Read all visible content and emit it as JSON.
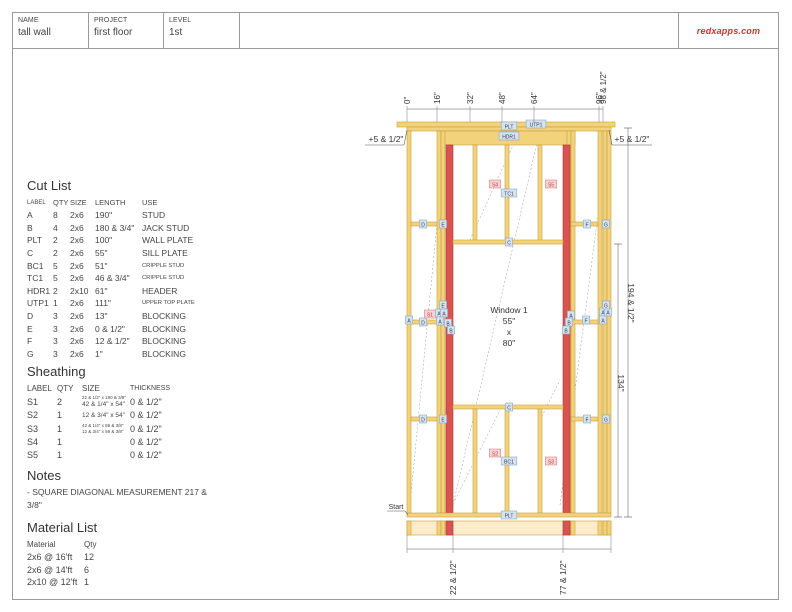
{
  "header": {
    "name_label": "NAME",
    "name_value": "tall wall",
    "project_label": "PROJECT",
    "project_value": "first floor",
    "level_label": "LEVEL",
    "level_value": "1st",
    "logo": "redxapps.com",
    "logo_color": "#d23030"
  },
  "cut_list": {
    "title": "Cut List",
    "headers": [
      "LABEL",
      "QTY",
      "SIZE",
      "LENGTH",
      "USE"
    ],
    "rows": [
      {
        "label": "A",
        "qty": "8",
        "size": "2x6",
        "length": "190\"",
        "use": "STUD",
        "small": false
      },
      {
        "label": "B",
        "qty": "4",
        "size": "2x6",
        "length": "180 & 3/4\"",
        "use": "JACK STUD",
        "small": false
      },
      {
        "label": "PLT",
        "qty": "2",
        "size": "2x6",
        "length": "100\"",
        "use": "WALL PLATE",
        "small": false
      },
      {
        "label": "C",
        "qty": "2",
        "size": "2x6",
        "length": "55\"",
        "use": "SILL PLATE",
        "small": false
      },
      {
        "label": "BC1",
        "qty": "5",
        "size": "2x6",
        "length": "51\"",
        "use": "CRIPPLE STUD",
        "small": true
      },
      {
        "label": "TC1",
        "qty": "5",
        "size": "2x6",
        "length": "46 & 3/4\"",
        "use": "CRIPPLE STUD",
        "small": true
      },
      {
        "label": "HDR1",
        "qty": "2",
        "size": "2x10",
        "length": "61\"",
        "use": "HEADER",
        "small": false
      },
      {
        "label": "UTP1",
        "qty": "1",
        "size": "2x6",
        "length": "111\"",
        "use": "UPPER TOP PLATE",
        "small": true
      },
      {
        "label": "D",
        "qty": "3",
        "size": "2x6",
        "length": "13\"",
        "use": "BLOCKING",
        "small": false
      },
      {
        "label": "E",
        "qty": "3",
        "size": "2x6",
        "length": "0 & 1/2\"",
        "use": "BLOCKING",
        "small": false
      },
      {
        "label": "F",
        "qty": "3",
        "size": "2x6",
        "length": "12 & 1/2\"",
        "use": "BLOCKING",
        "small": false
      },
      {
        "label": "G",
        "qty": "3",
        "size": "2x6",
        "length": "1\"",
        "use": "BLOCKING",
        "small": false
      }
    ]
  },
  "sheathing": {
    "title": "Sheathing",
    "headers": [
      "LABEL",
      "QTY",
      "SIZE",
      "THICKNESS"
    ],
    "rows": [
      {
        "label": "S1",
        "qty": "2",
        "size_lines": [
          "22 & 1/2\" x 190 & 3/8\"",
          "42 & 1/4\" x 54\""
        ],
        "thickness": "0 & 1/2\""
      },
      {
        "label": "S2",
        "qty": "1",
        "size_lines": [
          "12 & 3/4\" x 54\""
        ],
        "thickness": "0 & 1/2\""
      },
      {
        "label": "S3",
        "qty": "1",
        "size_lines": [
          "42 & 1/4\" x 59 & 3/8\"",
          "12 & 3/4\" x 59 & 3/8\""
        ],
        "thickness": "0 & 1/2\""
      },
      {
        "label": "S4",
        "qty": "1",
        "size_lines": [],
        "thickness": "0 & 1/2\""
      },
      {
        "label": "S5",
        "qty": "1",
        "size_lines": [],
        "thickness": "0 & 1/2\""
      }
    ]
  },
  "notes": {
    "title": "Notes",
    "text": "- SQUARE DIAGONAL MEASUREMENT 217 & 3/8\""
  },
  "material_list": {
    "title": "Material List",
    "headers": [
      "Material",
      "Qty"
    ],
    "rows": [
      {
        "material": "2x6 @ 16'ft",
        "qty": "12"
      },
      {
        "material": "2x6 @ 14'ft",
        "qty": "6"
      },
      {
        "material": "2x10 @ 12'ft",
        "qty": "1"
      }
    ]
  },
  "drawing": {
    "colors": {
      "wood": "#f2d27a",
      "wood_edge": "#c9a13c",
      "jack": "#d9534f",
      "tag_bg": "#d6e4f0",
      "tag_border": "#8aa6c1",
      "sheath_tag_bg": "#f6d2d2",
      "sheath_tag_border": "#d48a8a"
    },
    "top_ticks": [
      "0\"",
      "16\"",
      "32\"",
      "48\"",
      "64\"",
      "96\"",
      "98 & 1/2\""
    ],
    "overhang_left": "+5 & 1/2\"",
    "overhang_right": "+5 & 1/2\"",
    "height_total": "194 & 1/2\"",
    "height_window_bottom": "134\"",
    "bottom_dims": [
      "22 & 1/2\"",
      "77 & 1/2\""
    ],
    "start_label": "Start",
    "window": {
      "name": "Window 1",
      "width": "55\"",
      "x": "x",
      "height": "80\""
    },
    "tags": {
      "plt": "PLT",
      "hdr": "HDR1",
      "utp": "UTP1",
      "tc": "TC1",
      "bc": "BC1",
      "c": "C",
      "a": "A",
      "b": "B",
      "d": "D",
      "e": "E",
      "f": "F",
      "g": "G",
      "s1": "S1",
      "s2": "S2",
      "s3": "S3",
      "s4": "S4",
      "s5": "S5"
    }
  }
}
